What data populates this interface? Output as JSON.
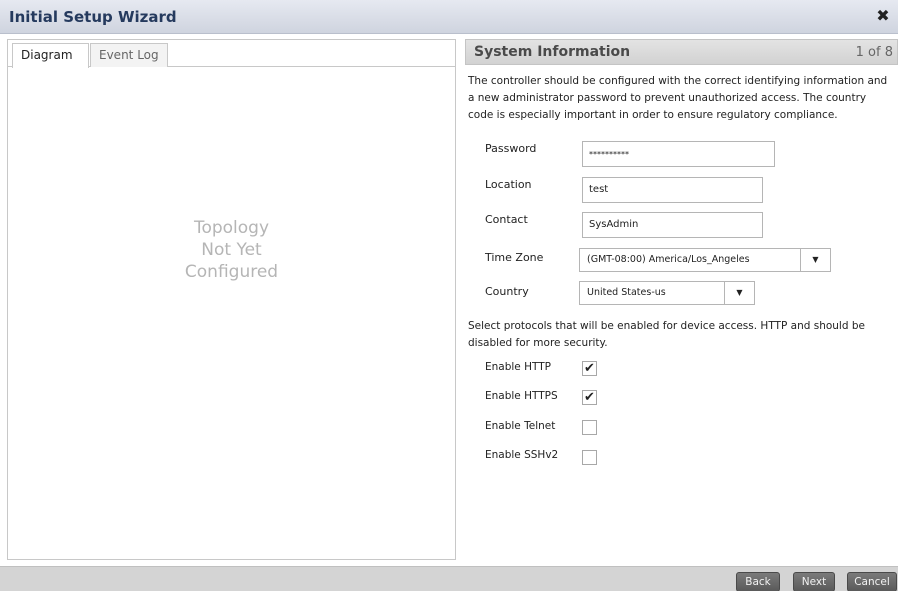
{
  "window": {
    "title": "Initial Setup Wizard",
    "close_icon": "✖"
  },
  "left_panel": {
    "tabs": [
      {
        "label": "Diagram",
        "active": true
      },
      {
        "label": "Event Log",
        "active": false
      }
    ],
    "placeholder_lines": [
      "Topology",
      "Not Yet",
      "Configured"
    ]
  },
  "right_panel": {
    "section_title": "System Information",
    "step": "1 of 8",
    "intro_lines": [
      "The controller should be configured with the correct identifying information and",
      "a new administrator password to prevent unauthorized access.  The country",
      "code is especially important in order to ensure regulatory compliance."
    ],
    "fields": {
      "password": {
        "label": "Password",
        "value": "**********"
      },
      "location": {
        "label": "Location",
        "value": "test"
      },
      "contact": {
        "label": "Contact",
        "value": "SysAdmin"
      },
      "time_zone": {
        "label": "Time Zone",
        "value": "(GMT-08:00) America/Los_Angeles"
      },
      "country": {
        "label": "Country",
        "value": "United States-us"
      }
    },
    "protocols_lines": [
      "Select protocols that will be enabled for device access.  HTTP and  should be",
      "disabled for more security."
    ],
    "protocols": [
      {
        "label": "Enable HTTP",
        "checked": true
      },
      {
        "label": "Enable HTTPS",
        "checked": true
      },
      {
        "label": "Enable Telnet",
        "checked": false
      },
      {
        "label": "Enable SSHv2",
        "checked": false
      }
    ],
    "check_glyph": "✔",
    "dropdown_glyph": "▼"
  },
  "footer": {
    "back_label": "Back",
    "next_label": "Next",
    "cancel_label": "Cancel"
  }
}
